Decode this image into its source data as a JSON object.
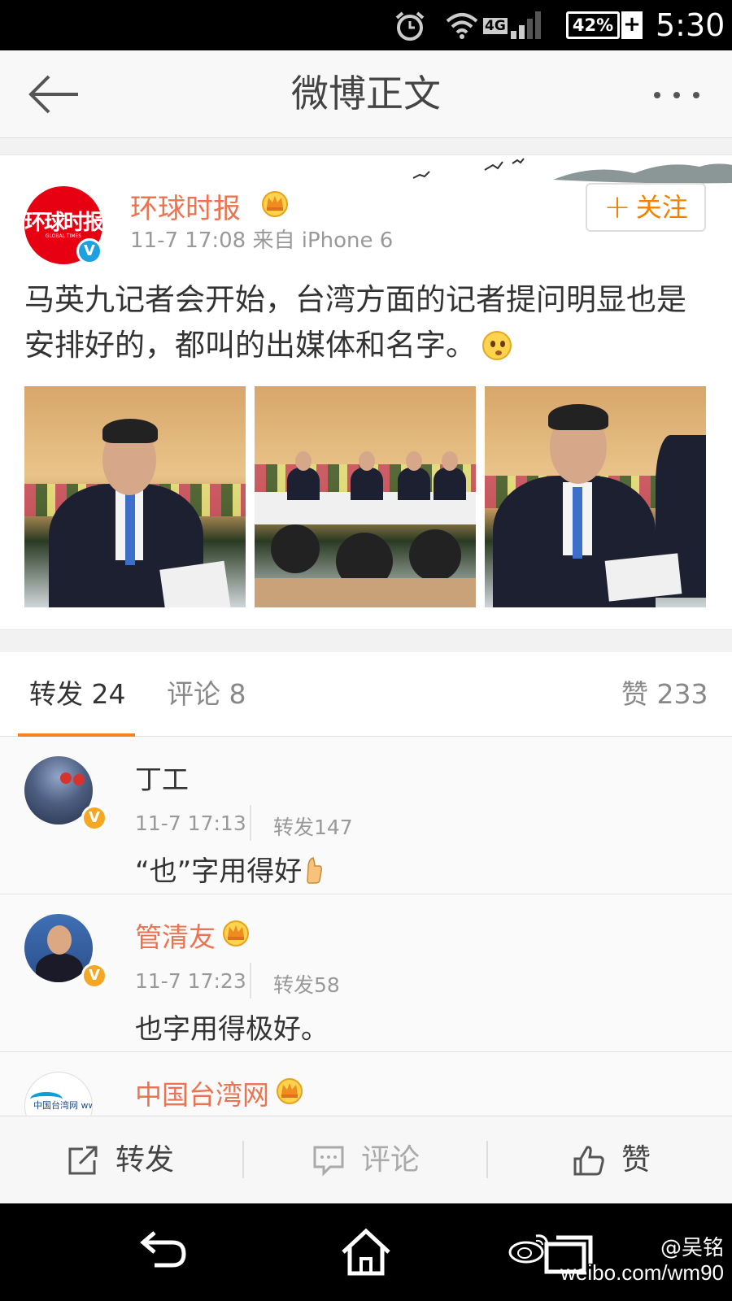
{
  "status_bar": {
    "battery": "42%",
    "network": "4G",
    "time": "5:30"
  },
  "header": {
    "title": "微博正文"
  },
  "post": {
    "author": "环球时报",
    "avatar_text": "环球时报",
    "avatar_subtext": "GLOBAL TIMES",
    "meta": "11-7 17:08  来自 iPhone 6",
    "follow_label": "关注",
    "content": "马英九记者会开始，台湾方面的记者提问明显也是安排好的，都叫的出媒体和名字。",
    "verified_badge": "V"
  },
  "tabs": {
    "repost": "转发 24",
    "comment": "评论 8",
    "like": "赞 233"
  },
  "reposts": [
    {
      "name": "丁工",
      "time": "11-7 17:13",
      "repost_count": "转发147",
      "text": "“也”字用得好",
      "badge": "V",
      "has_crown": false
    },
    {
      "name": "管清友",
      "time": "11-7 17:23",
      "repost_count": "转发58",
      "text": "也字用得极好。",
      "badge": "V",
      "has_crown": true
    },
    {
      "name": "中国台湾网",
      "avatar_text": "中国台湾网 www.taiwan.cn",
      "has_crown": true
    }
  ],
  "action_bar": {
    "repost": "转发",
    "comment": "评论",
    "like": "赞"
  },
  "watermark": {
    "handle": "@吴铭",
    "url": "weibo.com/wm90"
  },
  "colors": {
    "accent_orange": "#f58220",
    "name_orange": "#eb7350",
    "verified_blue": "#1e9fe0",
    "verified_gold": "#f5a623"
  },
  "icons": [
    "alarm-icon",
    "wifi-icon",
    "signal-icon",
    "battery-icon",
    "back-arrow-icon",
    "more-icon",
    "crown-icon",
    "repost-icon",
    "comment-icon",
    "like-icon",
    "nav-back-icon",
    "nav-home-icon",
    "nav-recents-icon",
    "weibo-logo-icon"
  ]
}
